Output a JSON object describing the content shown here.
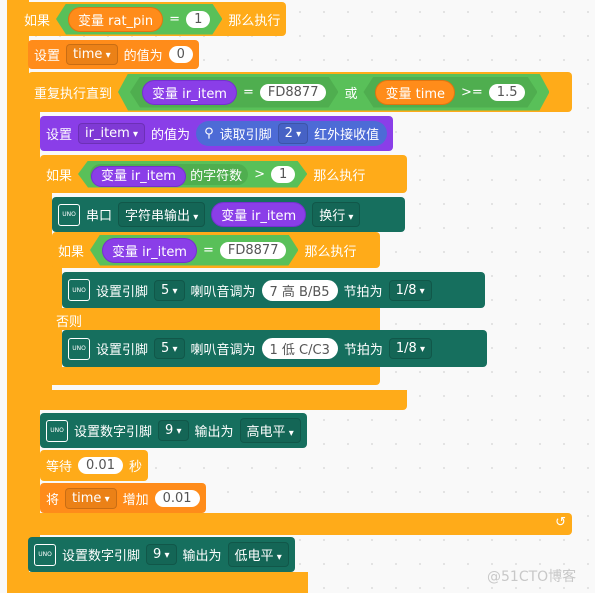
{
  "if1": {
    "kw": "如果",
    "var": "变量 rat_pin",
    "op": "=",
    "val": "1",
    "then": "那么执行"
  },
  "set_time": {
    "kw": "设置",
    "var": "time",
    "mid": "的值为",
    "val": "0"
  },
  "repeat": {
    "kw": "重复执行直到",
    "a_var": "变量 ir_item",
    "a_op": "=",
    "a_val": "FD8877",
    "or": "或",
    "b_var": "变量 time",
    "b_op": ">=",
    "b_val": "1.5"
  },
  "set_ir": {
    "kw": "设置",
    "var": "ir_item",
    "mid": "的值为",
    "read": "读取引脚",
    "pin": "2",
    "suffix": "红外接收值"
  },
  "if2": {
    "kw": "如果",
    "var": "变量 ir_item",
    "fn": "的字符数",
    "op": ">",
    "val": "1",
    "then": "那么执行"
  },
  "serial": {
    "board": "UNO",
    "kw": "串口",
    "mode": "字符串输出",
    "var": "变量 ir_item",
    "nl": "换行"
  },
  "if3": {
    "kw": "如果",
    "var": "变量 ir_item",
    "op": "=",
    "val": "FD8877",
    "then": "那么执行",
    "else": "否则"
  },
  "tone1": {
    "board": "UNO",
    "kw": "设置引脚",
    "pin": "5",
    "mid": "喇叭音调为",
    "note": "7 高 B/B5",
    "beat_kw": "节拍为",
    "beat": "1/8"
  },
  "tone2": {
    "board": "UNO",
    "kw": "设置引脚",
    "pin": "5",
    "mid": "喇叭音调为",
    "note": "1 低 C/C3",
    "beat_kw": "节拍为",
    "beat": "1/8"
  },
  "dig_high": {
    "board": "UNO",
    "kw": "设置数字引脚",
    "pin": "9",
    "mid": "输出为",
    "level": "高电平"
  },
  "wait": {
    "kw": "等待",
    "val": "0.01",
    "unit": "秒"
  },
  "inc": {
    "kw": "将",
    "var": "time",
    "mid": "增加",
    "val": "0.01"
  },
  "dig_low": {
    "board": "UNO",
    "kw": "设置数字引脚",
    "pin": "9",
    "mid": "输出为",
    "level": "低电平"
  },
  "watermark": "@51CTO博客"
}
